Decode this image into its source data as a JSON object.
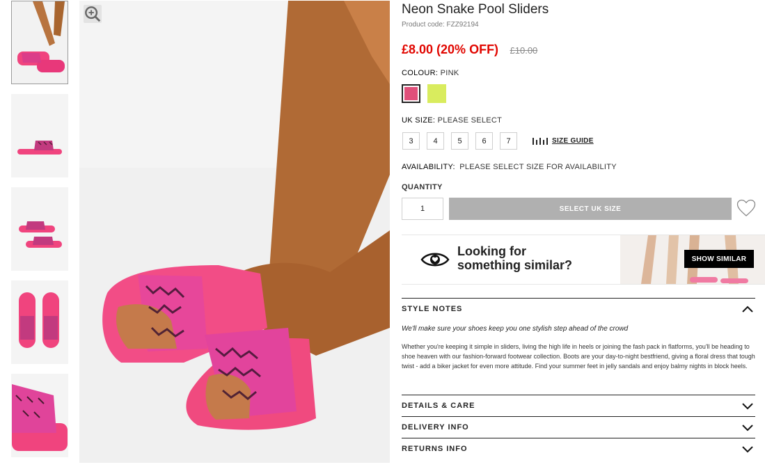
{
  "product": {
    "title": "Neon Snake Pool Sliders",
    "code": "Product code: FZZ92194",
    "price_now": "£8.00 (20% OFF)",
    "price_was": "£10.00"
  },
  "colour": {
    "label": "COLOUR:",
    "selected": "PINK",
    "swatches": [
      {
        "name": "pink",
        "hex": "#e0507a"
      },
      {
        "name": "lime",
        "hex": "#d9ec5e"
      }
    ]
  },
  "size": {
    "label": "UK SIZE:",
    "prompt": "PLEASE SELECT",
    "options": [
      "3",
      "4",
      "5",
      "6",
      "7"
    ],
    "guide_label": "SIZE GUIDE"
  },
  "availability": {
    "label": "AVAILABILITY:",
    "value": "PLEASE SELECT SIZE FOR AVAILABILITY"
  },
  "quantity": {
    "label": "QUANTITY",
    "value": "1"
  },
  "actions": {
    "add_label": "SELECT UK SIZE"
  },
  "similar": {
    "line1": "Looking for",
    "line2": "something similar?",
    "button": "SHOW SIMILAR"
  },
  "style_notes": {
    "heading": "STYLE NOTES",
    "tagline": "We'll make sure your shoes keep you one stylish step ahead of the crowd",
    "body": "Whether you're keeping it simple in sliders, living the high life in heels or joining the fash pack in flatforms, you'll be heading to shoe heaven with our fashion-forward footwear collection. Boots are your day-to-night bestfriend, giving a floral dress that tough twist - add a biker jacket for even more attitude. Find your summer feet in jelly sandals and enjoy balmy nights in block heels."
  },
  "accordions": [
    {
      "heading": "DETAILS & CARE"
    },
    {
      "heading": "DELIVERY INFO"
    },
    {
      "heading": "RETURNS INFO"
    }
  ],
  "colors": {
    "sale_red": "#e10600",
    "product_pink": "#f0447e",
    "button_grey": "#b0b0b0"
  }
}
